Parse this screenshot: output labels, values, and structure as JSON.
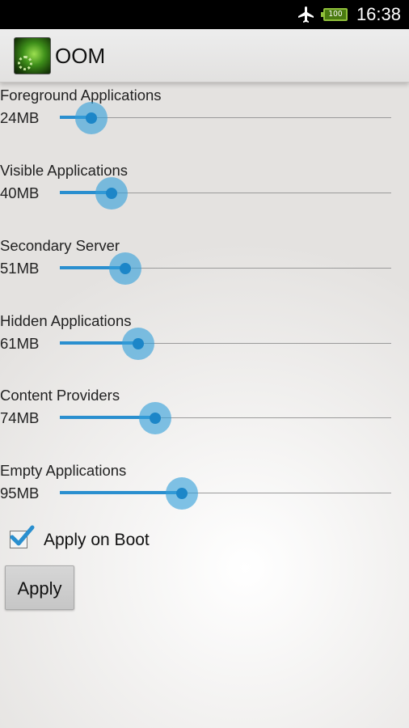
{
  "status_bar": {
    "time": "16:38",
    "battery_level": "100",
    "icons": [
      "airplane-mode-icon",
      "battery-icon"
    ]
  },
  "action_bar": {
    "title": "OOM",
    "icon": "app-launcher-icon"
  },
  "settings": [
    {
      "label": "Foreground Applications",
      "value": "24MB",
      "fraction": 0.095
    },
    {
      "label": "Visible Applications",
      "value": "40MB",
      "fraction": 0.155
    },
    {
      "label": "Secondary Server",
      "value": "51MB",
      "fraction": 0.198
    },
    {
      "label": "Hidden Applications",
      "value": "61MB",
      "fraction": 0.237
    },
    {
      "label": "Content Providers",
      "value": "74MB",
      "fraction": 0.287
    },
    {
      "label": "Empty Applications",
      "value": "95MB",
      "fraction": 0.368
    }
  ],
  "apply_on_boot": {
    "label": "Apply on Boot",
    "checked": true
  },
  "apply_button": {
    "label": "Apply"
  },
  "colors": {
    "accent": "#33b5e5",
    "slider_fill": "#2a8fcf",
    "status_bar": "#000000",
    "battery": "#8fc03a"
  }
}
